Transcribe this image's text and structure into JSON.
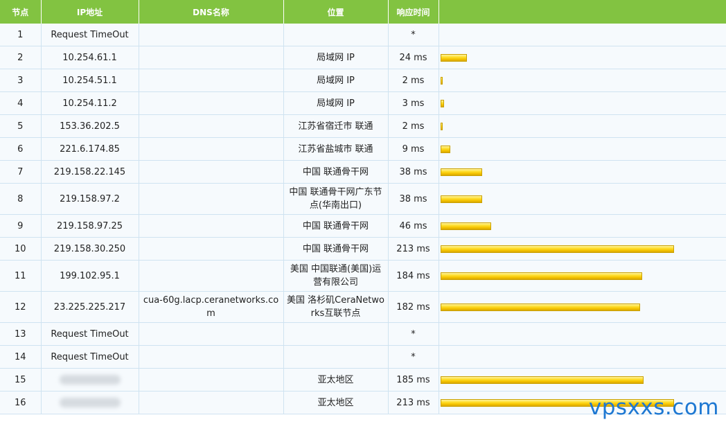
{
  "headers": [
    "节点",
    "IP地址",
    "DNS名称",
    "位置",
    "响应时间",
    ""
  ],
  "hops": [
    {
      "hop": "1",
      "ip": "Request TimeOut",
      "dns": "",
      "location": "",
      "time": "*",
      "ms": 0
    },
    {
      "hop": "2",
      "ip": "10.254.61.1",
      "dns": "",
      "location": "局域网 IP",
      "time": "24 ms",
      "ms": 24
    },
    {
      "hop": "3",
      "ip": "10.254.51.1",
      "dns": "",
      "location": "局域网 IP",
      "time": "2 ms",
      "ms": 2
    },
    {
      "hop": "4",
      "ip": "10.254.11.2",
      "dns": "",
      "location": "局域网 IP",
      "time": "3 ms",
      "ms": 3
    },
    {
      "hop": "5",
      "ip": "153.36.202.5",
      "dns": "",
      "location": "江苏省宿迁市 联通",
      "time": "2 ms",
      "ms": 2
    },
    {
      "hop": "6",
      "ip": "221.6.174.85",
      "dns": "",
      "location": "江苏省盐城市 联通",
      "time": "9 ms",
      "ms": 9
    },
    {
      "hop": "7",
      "ip": "219.158.22.145",
      "dns": "",
      "location": "中国 联通骨干网",
      "time": "38 ms",
      "ms": 38
    },
    {
      "hop": "8",
      "ip": "219.158.97.2",
      "dns": "",
      "location": "中国 联通骨干网广东节点(华南出口)",
      "time": "38 ms",
      "ms": 38
    },
    {
      "hop": "9",
      "ip": "219.158.97.25",
      "dns": "",
      "location": "中国 联通骨干网",
      "time": "46 ms",
      "ms": 46
    },
    {
      "hop": "10",
      "ip": "219.158.30.250",
      "dns": "",
      "location": "中国 联通骨干网",
      "time": "213 ms",
      "ms": 213
    },
    {
      "hop": "11",
      "ip": "199.102.95.1",
      "dns": "",
      "location": "美国 中国联通(美国)运营有限公司",
      "time": "184 ms",
      "ms": 184
    },
    {
      "hop": "12",
      "ip": "23.225.225.217",
      "dns": "cua-60g.lacp.ceranetworks.com",
      "location": "美国 洛杉矶CeraNetworks互联节点",
      "time": "182 ms",
      "ms": 182
    },
    {
      "hop": "13",
      "ip": "Request TimeOut",
      "dns": "",
      "location": "",
      "time": "*",
      "ms": 0
    },
    {
      "hop": "14",
      "ip": "Request TimeOut",
      "dns": "",
      "location": "",
      "time": "*",
      "ms": 0
    },
    {
      "hop": "15",
      "ip": "",
      "dns": "",
      "location": "亚太地区",
      "time": "185 ms",
      "ms": 185,
      "ip_redacted": true
    },
    {
      "hop": "16",
      "ip": "",
      "dns": "",
      "location": "亚太地区",
      "time": "213 ms",
      "ms": 213,
      "ip_redacted": true
    }
  ],
  "watermark": "vpsxxs.com",
  "colors": {
    "header_bg": "#82c341",
    "bar_fill": "#ffe033",
    "watermark": "#1e78d2"
  }
}
